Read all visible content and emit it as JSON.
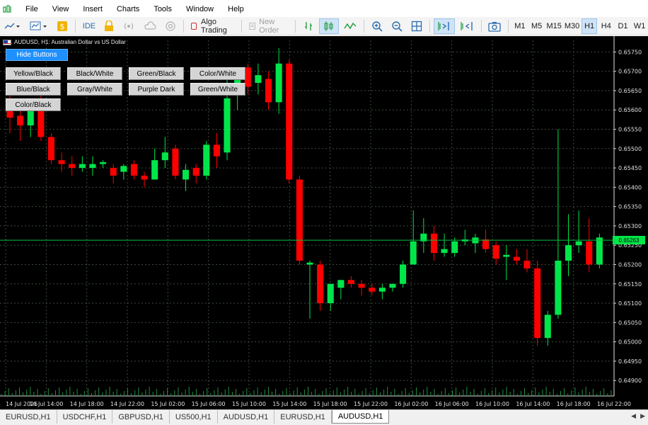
{
  "menu": {
    "items": [
      "File",
      "View",
      "Insert",
      "Charts",
      "Tools",
      "Window",
      "Help"
    ]
  },
  "toolbar": {
    "ide_label": "IDE",
    "algo_trading_label": "Algo Trading",
    "new_order_label": "New Order",
    "timeframes": [
      "M1",
      "M5",
      "M15",
      "M30",
      "H1",
      "H4",
      "D1",
      "W1"
    ],
    "active_timeframe": "H1"
  },
  "chart": {
    "title": "AUDUSD, H1:  Australian Dollar vs US Dollar",
    "current_price": "0.65263",
    "hide_buttons_label": "Hide Buttons",
    "theme_buttons": [
      "Yellow/Black",
      "Black/White",
      "Green/Black",
      "Color/White",
      "Blue/Black",
      "Gray/White",
      "Purple Dark",
      "Green/White",
      "Color/Black"
    ],
    "colors": {
      "background": "#000000",
      "bull": "#00e64a",
      "bear": "#ff0000",
      "grid": "#3a4a3a",
      "axis_text": "#e0e0e0",
      "price_line": "#00c040"
    }
  },
  "chart_data": {
    "type": "candlestick",
    "symbol": "AUDUSD",
    "timeframe": "H1",
    "ylim": [
      0.6486,
      0.6578
    ],
    "y_ticks": [
      "0.65750",
      "0.65700",
      "0.65650",
      "0.65600",
      "0.65550",
      "0.65500",
      "0.65450",
      "0.65400",
      "0.65350",
      "0.65300",
      "0.65250",
      "0.65200",
      "0.65150",
      "0.65100",
      "0.65050",
      "0.65000",
      "0.64950",
      "0.64900"
    ],
    "x_ticks": [
      "14 Jul 2025",
      "14 Jul 14:00",
      "14 Jul 18:00",
      "14 Jul 22:00",
      "15 Jul 02:00",
      "15 Jul 06:00",
      "15 Jul 10:00",
      "15 Jul 14:00",
      "15 Jul 18:00",
      "15 Jul 22:00",
      "16 Jul 02:00",
      "16 Jul 06:00",
      "16 Jul 10:00",
      "16 Jul 14:00",
      "16 Jul 18:00",
      "16 Jul 22:00"
    ],
    "ohlc": [
      [
        0.65612,
        0.6566,
        0.6554,
        0.6558
      ],
      [
        0.65585,
        0.656,
        0.6552,
        0.6556
      ],
      [
        0.6556,
        0.6561,
        0.6553,
        0.656
      ],
      [
        0.656,
        0.6564,
        0.6552,
        0.6553
      ],
      [
        0.6553,
        0.6554,
        0.6546,
        0.6547
      ],
      [
        0.6547,
        0.6549,
        0.6544,
        0.6546
      ],
      [
        0.6546,
        0.6548,
        0.6543,
        0.6545
      ],
      [
        0.6545,
        0.6548,
        0.6544,
        0.6546
      ],
      [
        0.6545,
        0.6548,
        0.6543,
        0.6546
      ],
      [
        0.6546,
        0.6547,
        0.6545,
        0.65465
      ],
      [
        0.6545,
        0.6546,
        0.6541,
        0.6543
      ],
      [
        0.6544,
        0.6546,
        0.6542,
        0.65455
      ],
      [
        0.6546,
        0.6547,
        0.6542,
        0.6543
      ],
      [
        0.6543,
        0.6544,
        0.654,
        0.6542
      ],
      [
        0.6542,
        0.655,
        0.6542,
        0.6547
      ],
      [
        0.6547,
        0.6553,
        0.6545,
        0.6549
      ],
      [
        0.655,
        0.6551,
        0.6542,
        0.6543
      ],
      [
        0.6542,
        0.6546,
        0.6539,
        0.65445
      ],
      [
        0.6545,
        0.6546,
        0.6541,
        0.6543
      ],
      [
        0.6543,
        0.6552,
        0.6542,
        0.6551
      ],
      [
        0.6551,
        0.6554,
        0.6545,
        0.6548
      ],
      [
        0.6549,
        0.6569,
        0.6547,
        0.6563
      ],
      [
        0.6564,
        0.6571,
        0.656,
        0.657
      ],
      [
        0.6571,
        0.6572,
        0.6564,
        0.6566
      ],
      [
        0.6567,
        0.6572,
        0.6564,
        0.6569
      ],
      [
        0.6568,
        0.657,
        0.656,
        0.6562
      ],
      [
        0.6562,
        0.6576,
        0.6559,
        0.6572
      ],
      [
        0.6572,
        0.6573,
        0.6541,
        0.6542
      ],
      [
        0.6542,
        0.6543,
        0.652,
        0.6521
      ],
      [
        0.652,
        0.6521,
        0.6506,
        0.65205
      ],
      [
        0.652,
        0.6521,
        0.6508,
        0.651
      ],
      [
        0.651,
        0.6515,
        0.6508,
        0.6515
      ],
      [
        0.6514,
        0.6516,
        0.6511,
        0.6516
      ],
      [
        0.6516,
        0.6517,
        0.6514,
        0.6515
      ],
      [
        0.6515,
        0.6516,
        0.6512,
        0.6514
      ],
      [
        0.6514,
        0.6515,
        0.6512,
        0.6513
      ],
      [
        0.6513,
        0.6515,
        0.6511,
        0.6514
      ],
      [
        0.6514,
        0.6515,
        0.6513,
        0.6515
      ],
      [
        0.6515,
        0.6521,
        0.6514,
        0.652
      ],
      [
        0.652,
        0.6534,
        0.652,
        0.6526
      ],
      [
        0.6526,
        0.6532,
        0.6523,
        0.6528
      ],
      [
        0.6528,
        0.653,
        0.6521,
        0.6523
      ],
      [
        0.6523,
        0.6528,
        0.6522,
        0.6524
      ],
      [
        0.6523,
        0.6527,
        0.6522,
        0.6526
      ],
      [
        0.6526,
        0.6529,
        0.6525,
        0.65265
      ],
      [
        0.65255,
        0.6528,
        0.6523,
        0.6527
      ],
      [
        0.65265,
        0.6529,
        0.6523,
        0.6524
      ],
      [
        0.6525,
        0.6526,
        0.652,
        0.65215
      ],
      [
        0.6522,
        0.6525,
        0.6516,
        0.65225
      ],
      [
        0.6522,
        0.6524,
        0.652,
        0.6521
      ],
      [
        0.6521,
        0.6524,
        0.6518,
        0.6519
      ],
      [
        0.6519,
        0.6521,
        0.6499,
        0.6501
      ],
      [
        0.6501,
        0.6508,
        0.6499,
        0.6507
      ],
      [
        0.6507,
        0.6555,
        0.6506,
        0.6521
      ],
      [
        0.6521,
        0.6533,
        0.6517,
        0.6525
      ],
      [
        0.6525,
        0.6534,
        0.6523,
        0.6526
      ],
      [
        0.6526,
        0.6532,
        0.6518,
        0.652
      ],
      [
        0.652,
        0.6528,
        0.6519,
        0.6527
      ]
    ]
  },
  "tabs": {
    "items": [
      "EURUSD,H1",
      "USDCHF,H1",
      "GBPUSD,H1",
      "US500,H1",
      "AUDUSD,H1",
      "EURUSD,H1",
      "AUDUSD,H1"
    ],
    "active_index": 6
  }
}
